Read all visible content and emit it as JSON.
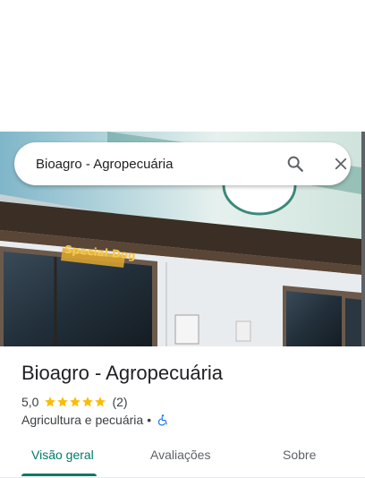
{
  "search": {
    "value": "Bioagro - Agropecuária",
    "search_icon": "search-icon",
    "close_icon": "close-icon"
  },
  "hero": {
    "sign_text": "Special Dog"
  },
  "place": {
    "title": "Bioagro - Agropecuária",
    "rating": "5,0",
    "stars": 5,
    "review_count": "(2)",
    "category": "Agricultura e pecuária",
    "separator": "•",
    "accessibility_icon": "wheelchair-icon"
  },
  "tabs": [
    {
      "label": "Visão geral",
      "active": true
    },
    {
      "label": "Avaliações",
      "active": false
    },
    {
      "label": "Sobre",
      "active": false
    }
  ],
  "colors": {
    "accent": "#00796b",
    "star": "#fbbc04",
    "accessibility": "#1a73e8"
  }
}
